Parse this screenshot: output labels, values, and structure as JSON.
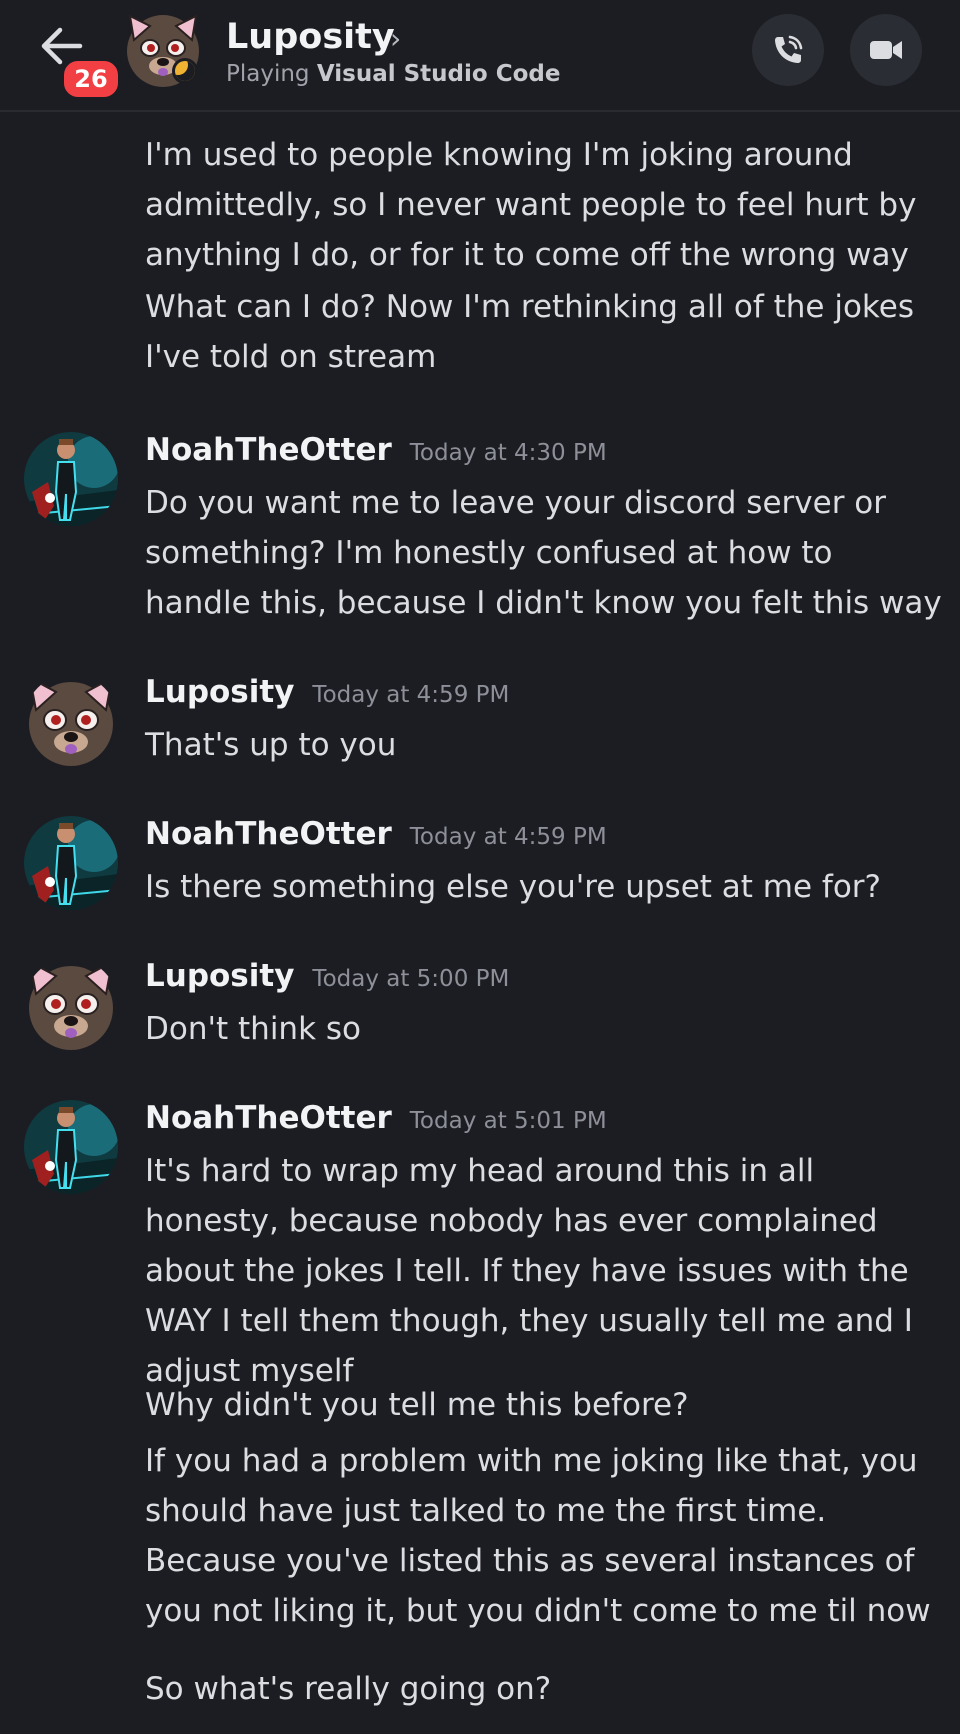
{
  "header": {
    "back_label": "←",
    "badge": "26",
    "title": "Luposity",
    "title_chevron": "›",
    "subtitle_prefix": "Playing ",
    "subtitle_activity": "Visual Studio Code"
  },
  "messages": [
    {
      "author": "",
      "time": "",
      "lines": [
        "I'm used to people knowing I'm joking around admittedly, so I never want people to feel hurt by anything I do, or for it to come off the wrong way",
        "What can I do? Now I'm rethinking all of the jokes I've told on stream"
      ]
    },
    {
      "author": "NoahTheOtter",
      "time": "Today at 4:30 PM",
      "lines": [
        "Do you want me to leave your discord server or something? I'm honestly confused at how to handle this, because I didn't know you felt this way"
      ]
    },
    {
      "author": "Luposity",
      "time": "Today at 4:59 PM",
      "lines": [
        "That's up to you"
      ]
    },
    {
      "author": "NoahTheOtter",
      "time": "Today at 4:59 PM",
      "lines": [
        "Is there something else you're upset at me for?"
      ]
    },
    {
      "author": "Luposity",
      "time": "Today at 5:00 PM",
      "lines": [
        "Don't think so"
      ]
    },
    {
      "author": "NoahTheOtter",
      "time": "Today at 5:01 PM",
      "lines": [
        "It's hard to wrap my head around this in all honesty, because nobody has ever complained about the jokes I tell. If they have issues with the WAY I tell them though, they usually tell me and I adjust myself",
        "Why didn't you tell me this before?",
        "If you had a problem with me joking like that, you should have just talked to me the first time. Because you've listed this as several instances of you not liking it, but you didn't come to me til now",
        "So what's really going on?"
      ]
    }
  ],
  "icons": {
    "back": "arrow-left-icon",
    "call": "phone-call-icon",
    "video": "video-camera-icon"
  },
  "colors": {
    "background": "#1c1d22",
    "badge": "#f23f43",
    "status_idle": "#f0b232",
    "text": "#dcdde1",
    "timestamp": "#8d9099"
  }
}
